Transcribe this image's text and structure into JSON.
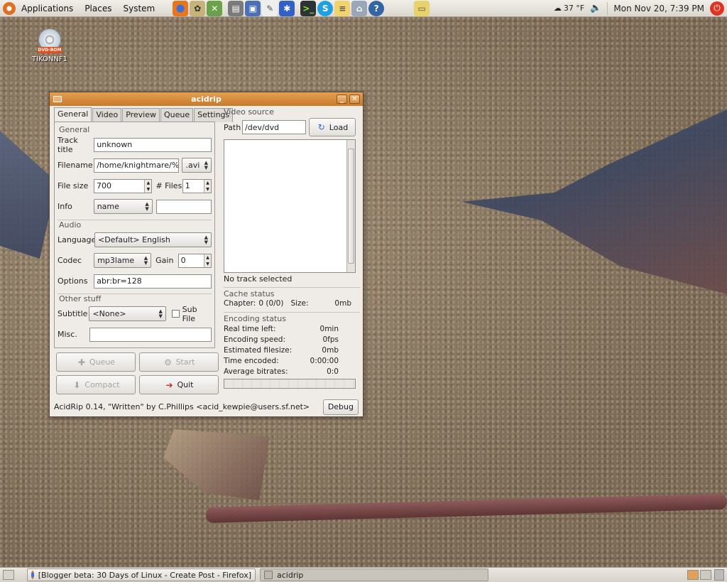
{
  "top_panel": {
    "menus": [
      "Applications",
      "Places",
      "System"
    ],
    "launchers": [
      "firefox-icon",
      "gaim-icon",
      "gimp-icon",
      "terminal-window-icon",
      "floppy-icon",
      "text-editor-icon",
      "bug-icon",
      "terminal-icon",
      "skype-icon",
      "notes-icon",
      "network-icon",
      "help-icon",
      "drive-icon"
    ],
    "weather": "37 °F",
    "clock": "Mon Nov 20,  7:39 PM"
  },
  "desktop": {
    "icon_badge": "DVD-ROM",
    "icon_label": "TIKONNF1"
  },
  "window": {
    "title": "acidrip",
    "tabs": [
      "General",
      "Video",
      "Preview",
      "Queue",
      "Settings"
    ],
    "general": {
      "group_label": "General",
      "track_title_label": "Track title",
      "track_title_value": "unknown",
      "filename_label": "Filename",
      "filename_value": "/home/knightmare/%T",
      "extension": ".avi",
      "file_size_label": "File size",
      "file_size_value": "700",
      "files_label": "# Files",
      "files_value": "1",
      "info_label": "Info",
      "info_value": "name",
      "info_extra": ""
    },
    "audio": {
      "group_label": "Audio",
      "language_label": "Language",
      "language_value": "<Default> English",
      "codec_label": "Codec",
      "codec_value": "mp3lame",
      "gain_label": "Gain",
      "gain_value": "0",
      "options_label": "Options",
      "options_value": "abr:br=128"
    },
    "other": {
      "group_label": "Other stuff",
      "subtitle_label": "Subtitle",
      "subtitle_value": "<None>",
      "subfile_label": "Sub File",
      "misc_label": "Misc.",
      "misc_value": ""
    },
    "buttons": {
      "queue": "Queue",
      "start": "Start",
      "compact": "Compact",
      "quit": "Quit"
    },
    "video_source": {
      "frame_label": "Video source",
      "path_label": "Path",
      "path_value": "/dev/dvd",
      "load_label": "Load",
      "no_track": "No track selected"
    },
    "cache_status": {
      "frame_label": "Cache status",
      "chapter_label": "Chapter:",
      "chapter_value": "0 (0/0)",
      "size_label": "Size:",
      "size_value": "0mb"
    },
    "encoding_status": {
      "frame_label": "Encoding status",
      "rows": [
        {
          "label": "Real time left:",
          "value": "0min"
        },
        {
          "label": "Encoding speed:",
          "value": "0fps"
        },
        {
          "label": "Estimated filesize:",
          "value": "0mb"
        },
        {
          "label": "Time encoded:",
          "value": "0:00:00"
        },
        {
          "label": "Average bitrates:",
          "value": "0:0"
        }
      ]
    },
    "status_text": "AcidRip 0.14, \"Written\" by C.Phillips <acid_kewpie@users.sf.net>",
    "debug_label": "Debug"
  },
  "bottom_panel": {
    "tasks": [
      {
        "label": "[Blogger beta: 30 Days of Linux - Create Post - Firefox]"
      },
      {
        "label": "acidrip"
      }
    ]
  },
  "colors": {
    "title_bar": "#d18a38",
    "panel": "#e6e2db",
    "window_bg": "#efebe7"
  }
}
